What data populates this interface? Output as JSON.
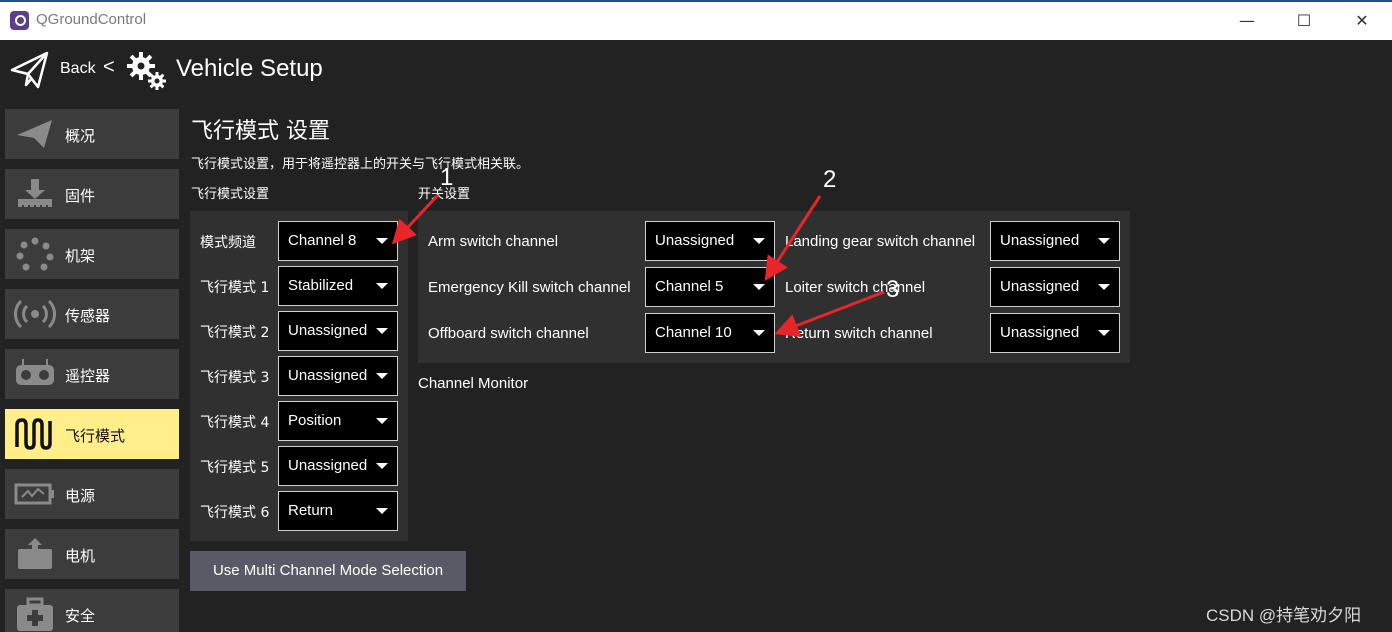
{
  "window": {
    "title": "QGroundControl",
    "controls": [
      "—",
      "☐",
      "✕"
    ]
  },
  "header": {
    "back_label": "Back",
    "separator": "<",
    "title": "Vehicle Setup",
    "plane_icon": "paper-plane-icon",
    "gears_icon": "gears-icon"
  },
  "sidebar": {
    "active_color": "#ffee8a",
    "items": [
      {
        "label": "概况",
        "icon": "plane-icon"
      },
      {
        "label": "固件",
        "icon": "download-firmware-icon"
      },
      {
        "label": "机架",
        "icon": "airframe-dots-icon"
      },
      {
        "label": "传感器",
        "icon": "sensors-icon"
      },
      {
        "label": "遥控器",
        "icon": "remote-control-icon"
      },
      {
        "label": "飞行模式",
        "icon": "flight-modes-icon",
        "active": true
      },
      {
        "label": "电源",
        "icon": "battery-icon"
      },
      {
        "label": "电机",
        "icon": "motor-icon"
      },
      {
        "label": "安全",
        "icon": "safety-kit-icon"
      }
    ]
  },
  "main": {
    "title": "飞行模式 设置",
    "description": "飞行模式设置，用于将遥控器上的开关与飞行模式相关联。",
    "modes_section_label": "飞行模式设置",
    "switch_section_label": "开关设置",
    "mode_channel": {
      "label": "模式频道",
      "value": "Channel 8"
    },
    "flight_modes": [
      {
        "label": "飞行模式 1",
        "value": "Stabilized"
      },
      {
        "label": "飞行模式 2",
        "value": "Unassigned"
      },
      {
        "label": "飞行模式 3",
        "value": "Unassigned"
      },
      {
        "label": "飞行模式 4",
        "value": "Position"
      },
      {
        "label": "飞行模式 5",
        "value": "Unassigned"
      },
      {
        "label": "飞行模式 6",
        "value": "Return"
      }
    ],
    "switches": [
      {
        "label": "Arm switch channel",
        "value": "Unassigned"
      },
      {
        "label": "Emergency Kill switch channel",
        "value": "Channel 5"
      },
      {
        "label": "Offboard switch channel",
        "value": "Channel 10"
      },
      {
        "label": "Landing gear switch channel",
        "value": "Unassigned"
      },
      {
        "label": "Loiter switch channel",
        "value": "Unassigned"
      },
      {
        "label": "Return switch channel",
        "value": "Unassigned"
      }
    ],
    "channel_monitor_label": "Channel Monitor",
    "multi_channel_button": "Use Multi Channel Mode Selection"
  },
  "annotations": {
    "numbers": [
      "1",
      "2",
      "3"
    ],
    "arrow_color": "#e8262a"
  },
  "watermark": "CSDN @持笔劝夕阳"
}
